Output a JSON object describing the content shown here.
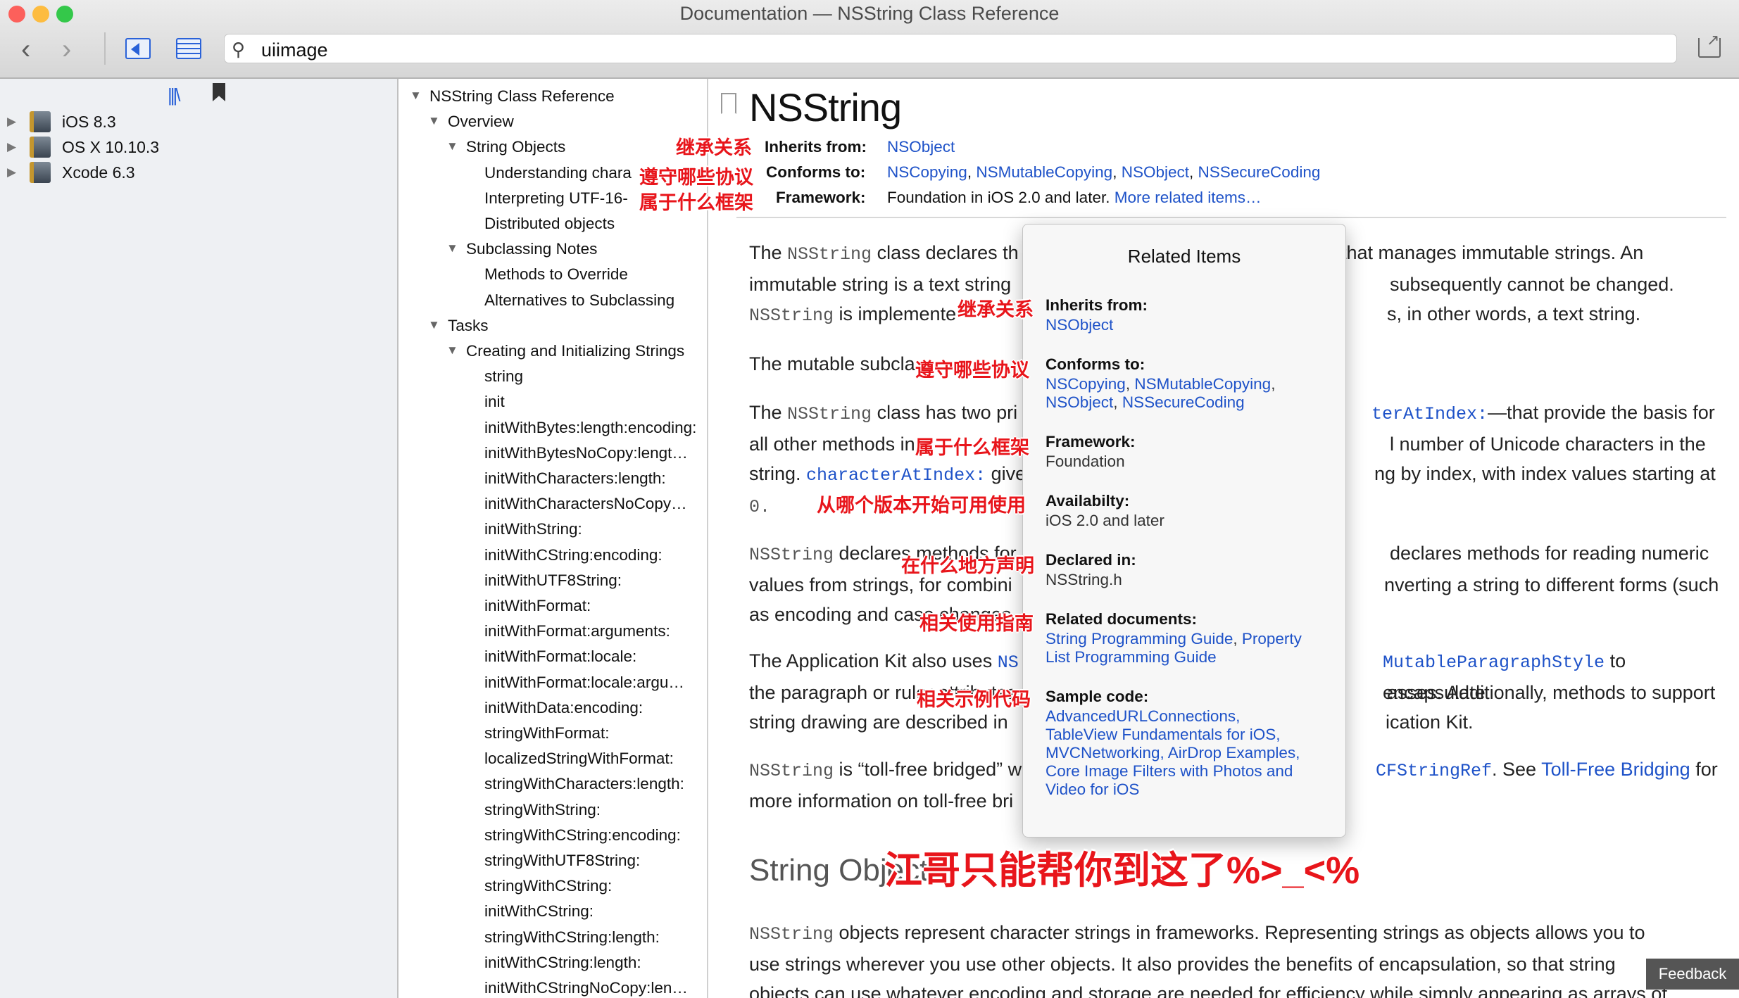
{
  "window": {
    "title": "Documentation — NSString Class Reference"
  },
  "colors": {
    "link": "#1e52c8",
    "annotation": "#e8151b",
    "close": "#fc605b",
    "minimize": "#fdbc40",
    "zoom": "#34c84a"
  },
  "toolbar": {
    "back_icon": "chevron-left-icon",
    "forward_icon": "chevron-right-icon",
    "search_value": "uiimage"
  },
  "sidebar": {
    "items": [
      {
        "label": "iOS 8.3"
      },
      {
        "label": "OS X 10.10.3"
      },
      {
        "label": "Xcode 6.3"
      }
    ]
  },
  "outline": {
    "items": [
      "NSString Class Reference",
      "Overview",
      "String Objects",
      "Understanding chara",
      "Interpreting UTF-16-",
      "Distributed objects",
      "Subclassing Notes",
      "Methods to Override",
      "Alternatives to Subclassing",
      "Tasks",
      "Creating and Initializing Strings",
      "string",
      "init",
      "initWithBytes:length:encoding:",
      "initWithBytesNoCopy:lengt…",
      "initWithCharacters:length:",
      "initWithCharactersNoCopy…",
      "initWithString:",
      "initWithCString:encoding:",
      "initWithUTF8String:",
      "initWithFormat:",
      "initWithFormat:arguments:",
      "initWithFormat:locale:",
      "initWithFormat:locale:argu…",
      "initWithData:encoding:",
      "stringWithFormat:",
      "localizedStringWithFormat:",
      "stringWithCharacters:length:",
      "stringWithString:",
      "stringWithCString:encoding:",
      "stringWithUTF8String:",
      "stringWithCString:",
      "initWithCString:",
      "stringWithCString:length:",
      "initWithCString:length:",
      "initWithCStringNoCopy:len…"
    ]
  },
  "doc": {
    "title": "NSString",
    "inherits_label": "Inherits from:",
    "inherits": "NSObject",
    "conforms_label": "Conforms to:",
    "conforms": [
      "NSCopying",
      "NSMutableCopying",
      "NSObject",
      "NSSecureCoding"
    ],
    "framework_label": "Framework:",
    "framework": "Foundation in iOS 2.0 and later.",
    "more_link": "More related items…",
    "p1a": "The ",
    "p1code": "NSString",
    "p1b": " class declares th",
    "p1c": "t that manages immutable strings. An",
    "p1d": "immutable string is a text string",
    "p1e": "subsequently cannot be changed.",
    "p1f": "NSString",
    "p1g": " is implemente",
    "p1h": "s, in other words, a text string.",
    "p2": "The mutable subcla",
    "p3a": "The ",
    "p3code": "NSString",
    "p3b": " class has two pri",
    "p3link": "terAtIndex:",
    "p3c": "—that provide the basis for",
    "p3d": "all other methods in",
    "p3e": "l number of Unicode characters in the",
    "p3f": "string. ",
    "p3link2": "characterAtIndex:",
    "p3g": " give",
    "p3h": "ng by index, with index values starting at",
    "p3i": "0.",
    "p4code": "NSString",
    "p4a": " declares methods for",
    "p4b": "declares methods for reading numeric",
    "p4c": "values from strings, for combini",
    "p4d": "nverting a string to different forms (such",
    "p4e": "as encoding and case changes",
    "p5a": "The Application Kit also uses ",
    "p5link": "NS",
    "p5linkb": "MutableParagraphStyle",
    "p5b": " to encapsulate",
    "p5c": "the paragraph or ruler attributes",
    "p5d": "asses. Additionally, methods to support",
    "p5e": "string drawing are described in",
    "p5f": "ication Kit.",
    "p6code": "NSString",
    "p6a": " is “toll-free bridged” w",
    "p6link": "CFStringRef",
    "p6b": ". See ",
    "p6link2": "Toll-Free Bridging",
    "p6c": " for",
    "p6d": "more information on toll-free bri",
    "section": "String Objects",
    "p7code": "NSString",
    "p7a": " objects represent character strings in frameworks. Representing strings as objects allows you to",
    "p7b": "use strings wherever you use other objects. It also provides the benefits of encapsulation, so that string",
    "p7c": "objects can use whatever encoding and storage are needed for efficiency while simply appearing as arrays of"
  },
  "popover": {
    "title": "Related Items",
    "inherits_label": "Inherits from:",
    "inherits": "NSObject",
    "conforms_label": "Conforms to:",
    "conforms_line1a": "NSCopying",
    "conforms_line1b": "NSMutableCopying",
    "conforms_line2a": "NSObject",
    "conforms_line2b": "NSSecureCoding",
    "framework_label": "Framework:",
    "framework": "Foundation",
    "availability_label": "Availabilty:",
    "availability": "iOS 2.0 and later",
    "declared_label": "Declared in:",
    "declared": "NSString.h",
    "related_label": "Related documents:",
    "related_line1a": "String Programming Guide",
    "related_line1b": "Property",
    "related_line2": "List Programming Guide",
    "sample_label": "Sample code:",
    "sample_line1": "AdvancedURLConnections,",
    "sample_line2": "TableView Fundamentals for iOS,",
    "sample_line3": "MVCNetworking, AirDrop Examples,",
    "sample_line4": "Core Image Filters with Photos and",
    "sample_line5": "Video for iOS"
  },
  "annotations": {
    "inherit": "继承关系",
    "protocols": "遵守哪些协议",
    "framework": "属于什么框架",
    "version": "从哪个版本开始可用使用",
    "declared": "在什么地方声明",
    "guide": "相关使用指南",
    "sample": "相关示例代码",
    "big": "江哥只能帮你到这了%>_<%"
  },
  "feedback": "Feedback"
}
